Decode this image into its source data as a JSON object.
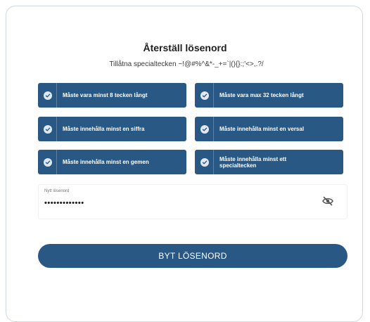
{
  "form": {
    "title": "Återställ lösenord",
    "allowed_special_chars": "Tillåtna specialtecken ~!@#%^&*-_+=`|(){}:;'<>,.?/"
  },
  "rules": [
    {
      "label": "Måste vara minst 8 tecken långt",
      "met": true
    },
    {
      "label": "Måste vara max 32 tecken långt",
      "met": true
    },
    {
      "label": "Måste innehålla minst en siffra",
      "met": true
    },
    {
      "label": "Måste innehålla minst en versal",
      "met": true
    },
    {
      "label": "Måste innehålla minst en gemen",
      "met": true
    },
    {
      "label": "Måste innehålla minst ett specialtecken",
      "met": true
    }
  ],
  "password_field": {
    "label": "Nytt lösenord",
    "value": "•••••••••••••",
    "visibility_icon": "eye-slash-icon"
  },
  "submit": {
    "label": "BYT LÖSENORD"
  },
  "colors": {
    "accent": "#2a5885",
    "check_bg": "#dfe8f1"
  }
}
